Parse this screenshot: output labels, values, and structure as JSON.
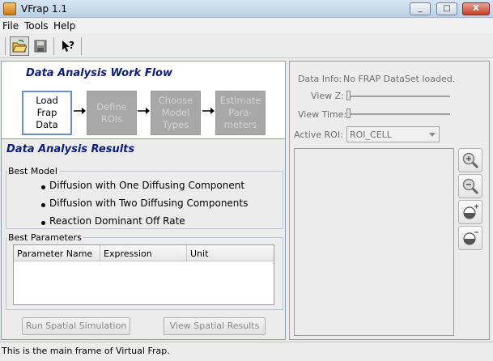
{
  "window": {
    "title": "VFrap 1.1",
    "minimize": "_",
    "maximize": "□",
    "close": "X"
  },
  "menu": {
    "items": [
      "File",
      "Tools",
      "Help"
    ]
  },
  "toolbar": {
    "buttons": [
      "open-folder-icon",
      "save-icon",
      "context-help-icon"
    ]
  },
  "workflow": {
    "title": "Data Analysis Work Flow",
    "steps": [
      {
        "label": "Load\nFrap\nData",
        "state": "active"
      },
      {
        "label": "Define\nROIs",
        "state": "disabled"
      },
      {
        "label": "Choose\nModel\nTypes",
        "state": "disabled"
      },
      {
        "label": "Estimate\nPara-\nmeters",
        "state": "disabled"
      }
    ]
  },
  "results": {
    "title": "Data Analysis Results",
    "best_model": {
      "label": "Best Model",
      "models": [
        "Diffusion with One Diffusing Component",
        "Diffusion with Two Diffusing Components",
        "Reaction Dominant Off Rate"
      ]
    },
    "best_parameters": {
      "label": "Best Parameters",
      "columns": [
        "Parameter Name",
        "Expression",
        "Unit"
      ]
    },
    "buttons": {
      "run": "Run Spatial Simulation",
      "view": "View Spatial Results"
    }
  },
  "viewer": {
    "data_info_label": "Data Info:",
    "data_info_value": "No FRAP DataSet loaded.",
    "view_z_label": "View Z:",
    "view_time_label": "View Time:",
    "active_roi_label": "Active ROI:",
    "active_roi_value": "ROI_CELL"
  },
  "status": {
    "text": "This is the main frame of Virtual Frap."
  }
}
